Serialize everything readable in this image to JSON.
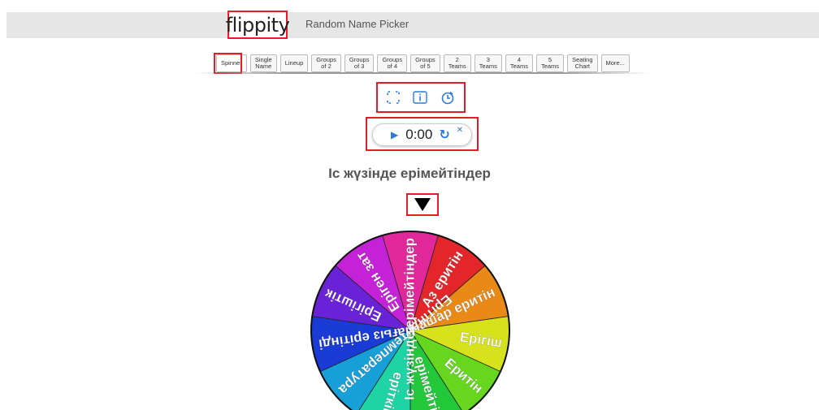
{
  "header": {
    "logo_text": "flippity",
    "app_title": "Random Name Picker"
  },
  "tabs": [
    {
      "label": "Spinner",
      "active": true
    },
    {
      "label": "Single\nName"
    },
    {
      "label": "Lineup"
    },
    {
      "label": "Groups\nof 2"
    },
    {
      "label": "Groups\nof 3"
    },
    {
      "label": "Groups\nof 4"
    },
    {
      "label": "Groups\nof 5"
    },
    {
      "label": "2\nTeams"
    },
    {
      "label": "3\nTeams"
    },
    {
      "label": "4\nTeams"
    },
    {
      "label": "5\nTeams"
    },
    {
      "label": "Seating\nChart"
    },
    {
      "label": "More..."
    }
  ],
  "toolbar": {
    "fullscreen_icon": "fullscreen-icon",
    "info_icon": "info-icon",
    "timer_icon": "timer-icon"
  },
  "timer": {
    "time": "0:00",
    "play_icon": "play-icon",
    "reset_icon": "reset-icon",
    "close_icon": "close-icon"
  },
  "wheel": {
    "title": "Іс жүзінде ерімейтіндер",
    "colors": {
      "accent": "#2d7bd6",
      "highlight": "#e11d2a"
    },
    "segments": [
      {
        "label": "Іс жүзінде ерімейтіндер",
        "color": "#e0289b"
      },
      {
        "label": "Аз еритін",
        "color": "#e2262a"
      },
      {
        "label": "Нашар еритін",
        "color": "#ea8a16"
      },
      {
        "label": "Ерігіш",
        "color": "#d6e21c"
      },
      {
        "label": "Еритін",
        "color": "#66d61e"
      },
      {
        "label": "ерімейтін",
        "color": "#22c73a"
      },
      {
        "label": "еріткіш",
        "color": "#1ed3a4"
      },
      {
        "label": "Ерітінді температура",
        "color": "#179fd8"
      },
      {
        "label": "Нағыз ерітінді",
        "color": "#1a3bd6"
      },
      {
        "label": "Ерігіштік",
        "color": "#6a22d6"
      },
      {
        "label": "Еріген зат",
        "color": "#c322d6"
      }
    ]
  }
}
